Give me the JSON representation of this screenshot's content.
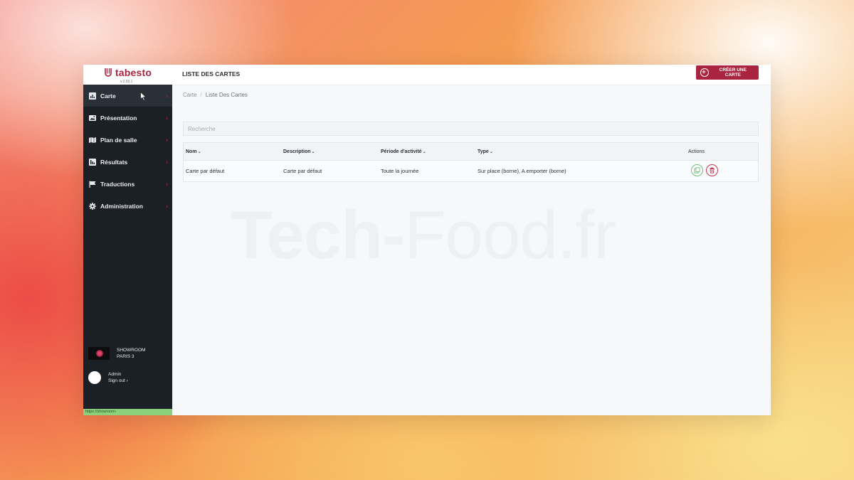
{
  "app": {
    "logo_text": "tabesto",
    "version": "v.2.93.1"
  },
  "sidebar": {
    "items": [
      {
        "label": "Carte",
        "icon": "bar-chart-icon"
      },
      {
        "label": "Présentation",
        "icon": "image-icon"
      },
      {
        "label": "Plan de salle",
        "icon": "map-icon"
      },
      {
        "label": "Résultats",
        "icon": "results-icon"
      },
      {
        "label": "Traductions",
        "icon": "flag-icon"
      },
      {
        "label": "Administration",
        "icon": "gear-icon"
      }
    ],
    "chevron": "›",
    "org": {
      "line1": "SHOWROOM",
      "line2": "PARIS 3"
    },
    "user": {
      "name": "Admin",
      "signout": "Sign out ›"
    }
  },
  "header": {
    "title": "LISTE DES CARTES",
    "create_button": "CRÉER UNE CARTE"
  },
  "breadcrumb": {
    "root": "Carte",
    "separator": "/",
    "current": "Liste Des Cartes"
  },
  "search": {
    "placeholder": "Recherche"
  },
  "table": {
    "columns": [
      "Nom",
      "Description",
      "Période d'activité",
      "Type",
      "Actions"
    ],
    "sort_caret": "⌄",
    "rows": [
      {
        "nom": "Carte par défaut",
        "description": "Carte par défaut",
        "periode": "Toute la journée",
        "type": "Sur place (borne), A emporter (borne)"
      }
    ]
  },
  "status_bar": {
    "url": "https://showroom-1002.devto.tabesto.com/menus/list#"
  },
  "watermark": {
    "part1": "Tech-",
    "part2": "Food.fr"
  },
  "colors": {
    "brand": "#a8243f",
    "sidebar_bg": "#1b2026",
    "copy_action": "#6cc07a",
    "delete_action": "#c0394d"
  }
}
